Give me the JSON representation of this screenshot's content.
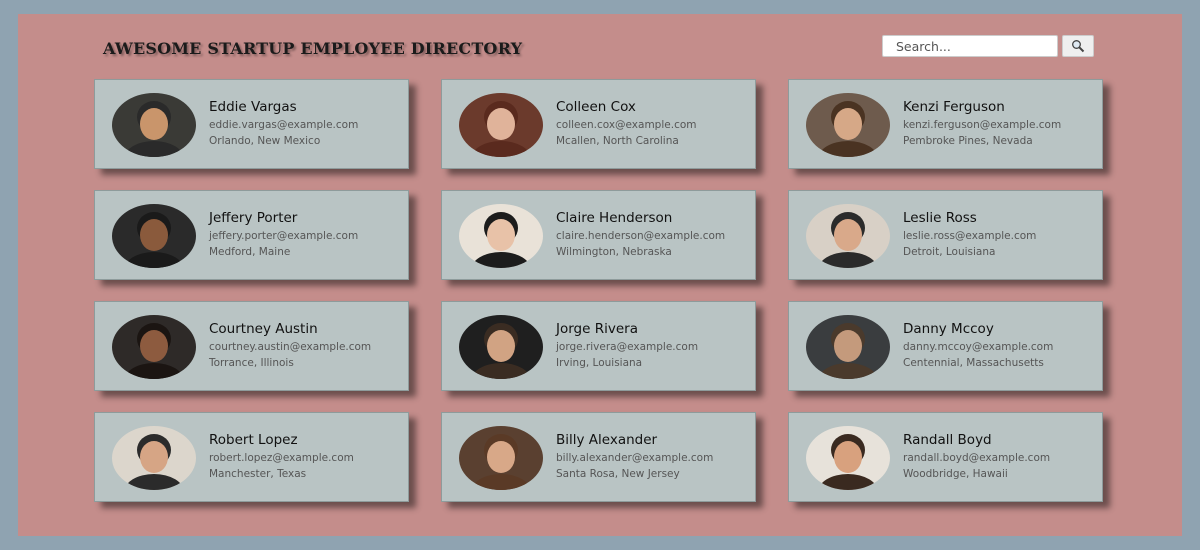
{
  "header": {
    "title": "AWESOME STARTUP EMPLOYEE DIRECTORY"
  },
  "search": {
    "placeholder": "Search...",
    "button_icon": "search-icon"
  },
  "employees": [
    {
      "name": "Eddie Vargas",
      "email": "eddie.vargas@example.com",
      "location": "Orlando, New Mexico",
      "avatar": {
        "bg": "#3a3a36",
        "skin": "#c9956b",
        "hair": "#2a2a2a"
      }
    },
    {
      "name": "Colleen Cox",
      "email": "colleen.cox@example.com",
      "location": "Mcallen, North Carolina",
      "avatar": {
        "bg": "#6b3a2c",
        "skin": "#e0b39a",
        "hair": "#5a2a1e"
      }
    },
    {
      "name": "Kenzi Ferguson",
      "email": "kenzi.ferguson@example.com",
      "location": "Pembroke Pines, Nevada",
      "avatar": {
        "bg": "#6e5b4d",
        "skin": "#d6a887",
        "hair": "#4a3322"
      }
    },
    {
      "name": "Jeffery Porter",
      "email": "jeffery.porter@example.com",
      "location": "Medford, Maine",
      "avatar": {
        "bg": "#2a2a2a",
        "skin": "#8a5a3c",
        "hair": "#1a1a1a"
      }
    },
    {
      "name": "Claire Henderson",
      "email": "claire.henderson@example.com",
      "location": "Wilmington, Nebraska",
      "avatar": {
        "bg": "#e9e2d8",
        "skin": "#e8c2a8",
        "hair": "#1c1c1c"
      }
    },
    {
      "name": "Leslie Ross",
      "email": "leslie.ross@example.com",
      "location": "Detroit, Louisiana",
      "avatar": {
        "bg": "#d8d0c6",
        "skin": "#d9a98a",
        "hair": "#2b2b2b"
      }
    },
    {
      "name": "Courtney Austin",
      "email": "courtney.austin@example.com",
      "location": "Torrance, Illinois",
      "avatar": {
        "bg": "#2e2a28",
        "skin": "#8d5b3f",
        "hair": "#1b1512"
      }
    },
    {
      "name": "Jorge Rivera",
      "email": "jorge.rivera@example.com",
      "location": "Irving, Louisiana",
      "avatar": {
        "bg": "#1f1f1f",
        "skin": "#d1a383",
        "hair": "#3a2c22"
      }
    },
    {
      "name": "Danny Mccoy",
      "email": "danny.mccoy@example.com",
      "location": "Centennial, Massachusetts",
      "avatar": {
        "bg": "#3a3d3f",
        "skin": "#c49a7c",
        "hair": "#4a3a2c"
      }
    },
    {
      "name": "Robert Lopez",
      "email": "robert.lopez@example.com",
      "location": "Manchester, Texas",
      "avatar": {
        "bg": "#dcd6cc",
        "skin": "#d6a585",
        "hair": "#2b2b2b"
      }
    },
    {
      "name": "Billy Alexander",
      "email": "billy.alexander@example.com",
      "location": "Santa Rosa, New Jersey",
      "avatar": {
        "bg": "#5a4030",
        "skin": "#d8a888",
        "hair": "#5a3a26"
      }
    },
    {
      "name": "Randall Boyd",
      "email": "randall.boyd@example.com",
      "location": "Woodbridge, Hawaii",
      "avatar": {
        "bg": "#e7e2da",
        "skin": "#d8a17e",
        "hair": "#3a2a20"
      }
    }
  ]
}
